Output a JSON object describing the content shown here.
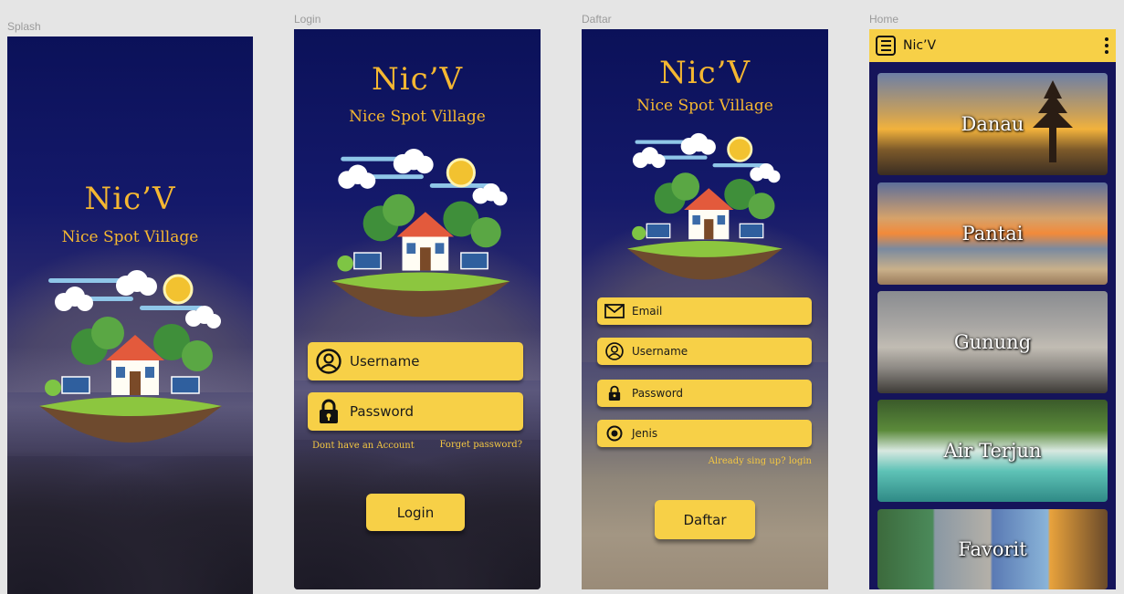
{
  "frames": {
    "splash_label": "Splash",
    "login_label": "Login",
    "daftar_label": "Daftar",
    "home_label": "Home"
  },
  "brand": {
    "title": "Nic’V",
    "subtitle": "Nice Spot Village",
    "color": "#f5b731"
  },
  "login": {
    "username_label": "Username",
    "password_label": "Password",
    "no_account_link": "Dont have an Account",
    "forget_link": "Forget password?",
    "login_button": "Login"
  },
  "daftar": {
    "email_label": "Email",
    "username_label": "Username",
    "password_label": "Password",
    "jenis_label": "Jenis",
    "already_link": "Already sing up? login",
    "daftar_button": "Daftar"
  },
  "home": {
    "app_title": "Nic’V",
    "categories": [
      {
        "label": "Danau",
        "icon": "lake-temple-photo"
      },
      {
        "label": "Pantai",
        "icon": "beach-photo"
      },
      {
        "label": "Gunung",
        "icon": "mountain-photo"
      },
      {
        "label": "Air Terjun",
        "icon": "waterfall-photo"
      },
      {
        "label": "Favorit",
        "icon": "favorites-collage"
      }
    ]
  },
  "colors": {
    "navy": "#0b1159",
    "accent_yellow": "#f7d047",
    "canvas": "#e5e5e5"
  }
}
